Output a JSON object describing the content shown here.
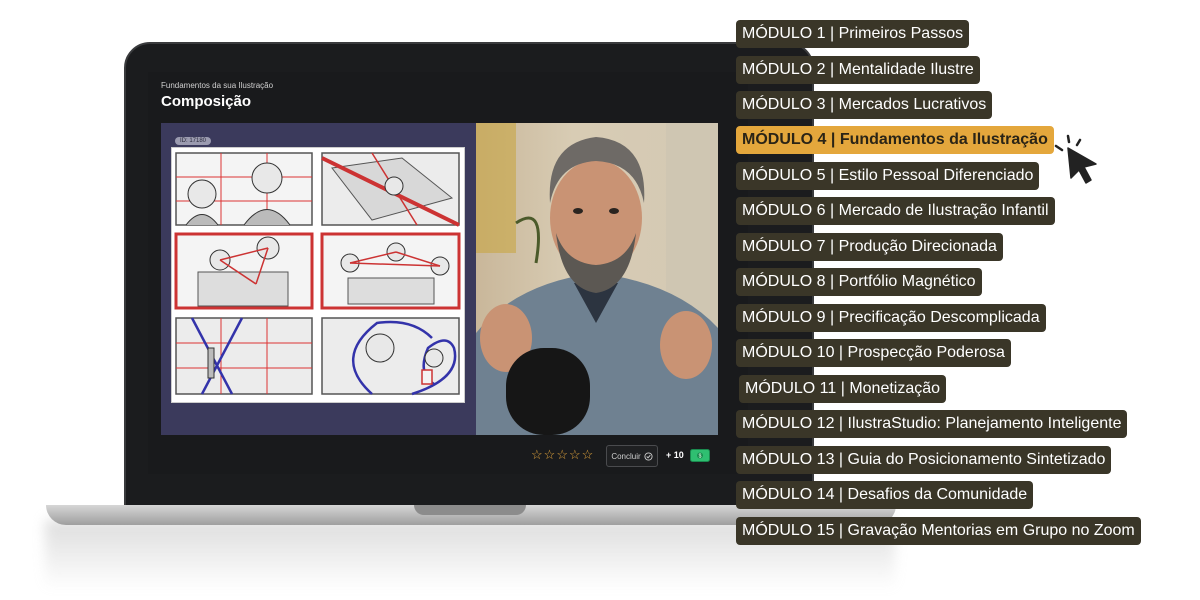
{
  "player": {
    "course_subtitle": "Fundamentos da sua Ilustração",
    "lesson_title": "Composição",
    "video_id": "ID: 17180",
    "rating_stars": 5,
    "rating_value": 0,
    "conclude_label": "Concluir",
    "points": "+ 10",
    "accent_color": "#e0a33c"
  },
  "modules": [
    {
      "label": "MÓDULO 1 | Primeiros Passos",
      "active": false
    },
    {
      "label": "MÓDULO 2 | Mentalidade Ilustre",
      "active": false
    },
    {
      "label": "MÓDULO 3 | Mercados Lucrativos",
      "active": false
    },
    {
      "label": "MÓDULO 4 | Fundamentos da Ilustração",
      "active": true
    },
    {
      "label": "MÓDULO 5 | Estilo Pessoal Diferenciado",
      "active": false
    },
    {
      "label": "MÓDULO 6 | Mercado de Ilustração Infantil",
      "active": false
    },
    {
      "label": "MÓDULO 7 | Produção Direcionada",
      "active": false
    },
    {
      "label": "MÓDULO 8 | Portfólio Magnético",
      "active": false
    },
    {
      "label": "MÓDULO 9 | Precificação Descomplicada",
      "active": false
    },
    {
      "label": "MÓDULO 10 | Prospecção Poderosa",
      "active": false
    },
    {
      "label": "MÓDULO 11 | Monetização",
      "active": false
    },
    {
      "label": "MÓDULO 12 | IlustraStudio: Planejamento Inteligente",
      "active": false
    },
    {
      "label": "MÓDULO 13 | Guia do Posicionamento Sintetizado",
      "active": false
    },
    {
      "label": "MÓDULO 14 | Desafios da Comunidade",
      "active": false
    },
    {
      "label": "MÓDULO 15 | Gravação Mentorias em Grupo no Zoom",
      "active": false
    }
  ],
  "icons": {
    "cursor": "pointer-cursor-icon",
    "check": "check-circle-icon",
    "money": "money-icon"
  }
}
